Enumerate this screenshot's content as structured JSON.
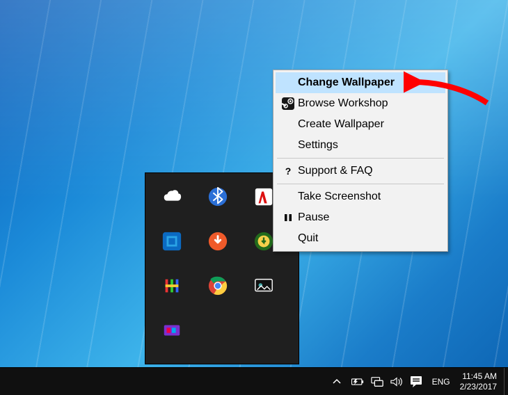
{
  "context_menu": {
    "items": [
      {
        "label": "Change Wallpaper",
        "bold": true,
        "highlight": true,
        "separator_after": false
      },
      {
        "label": "Browse Workshop",
        "icon": "steam"
      },
      {
        "label": "Create Wallpaper"
      },
      {
        "label": "Settings",
        "separator_after": true
      },
      {
        "label": "Support & FAQ",
        "icon": "question",
        "separator_after": true
      },
      {
        "label": "Take Screenshot"
      },
      {
        "label": "Pause",
        "icon": "pause"
      },
      {
        "label": "Quit"
      }
    ]
  },
  "tray_overflow_apps": [
    "onedrive",
    "bluetooth",
    "antivirus",
    "intel-graphics",
    "updater-red-arrow",
    "download-manager",
    "hotspot",
    "chrome",
    "wallpaper-engine",
    "media-app"
  ],
  "taskbar": {
    "systray_icons": [
      "battery",
      "network",
      "volume",
      "action-center"
    ],
    "language": "ENG",
    "clock": {
      "time": "11:45 AM",
      "date": "2/23/2017"
    }
  }
}
